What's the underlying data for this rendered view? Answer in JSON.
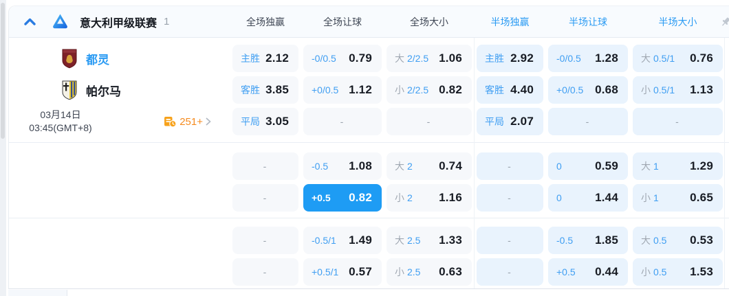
{
  "league": {
    "name": "意大利甲级联赛",
    "count": "1"
  },
  "header": {
    "columns": [
      {
        "label": "全场独赢",
        "tone": "dark"
      },
      {
        "label": "全场让球",
        "tone": "dark"
      },
      {
        "label": "全场大小",
        "tone": "dark"
      },
      {
        "label": "半场独赢",
        "tone": "blue"
      },
      {
        "label": "半场让球",
        "tone": "blue"
      },
      {
        "label": "半场大小",
        "tone": "blue"
      }
    ]
  },
  "teams": {
    "home": {
      "name": "都灵"
    },
    "away": {
      "name": "帕尔马"
    }
  },
  "schedule": {
    "date": "03月14日",
    "time": "03:45(GMT+8)"
  },
  "stats": {
    "count": "251+"
  },
  "icons": {
    "collapse": "chevron-up-icon",
    "league_logo": "serie-a-logo",
    "home_crest": "torino-crest",
    "away_crest": "parma-crest",
    "stats": "stats-history-icon",
    "more": "chevron-right-icon",
    "pin": "pin-icon"
  },
  "colors": {
    "accent_blue": "#2b9bf3",
    "label_blue": "#3f9ef2",
    "selected_cell_bg": "#1e9cf4",
    "full_cell_bg": "#f6f8fb",
    "half_cell_bg": "#e9f3fd",
    "value_dark": "#181c24",
    "muted_gray": "#9aa3ad",
    "stats_orange": "#f58b1f"
  },
  "odds": {
    "dash": "-",
    "groups": [
      {
        "rows": [
          [
            {
              "label": "主胜",
              "value": "2.12"
            },
            {
              "label": "-0/0.5",
              "value": "0.79"
            },
            {
              "prefix": "大",
              "label": "2/2.5",
              "value": "1.06"
            },
            {
              "label": "主胜",
              "value": "2.92"
            },
            {
              "label": "-0/0.5",
              "value": "1.28"
            },
            {
              "prefix": "大",
              "label": "0.5/1",
              "value": "0.76"
            }
          ],
          [
            {
              "label": "客胜",
              "value": "3.85"
            },
            {
              "label": "+0/0.5",
              "value": "1.12"
            },
            {
              "prefix": "小",
              "label": "2/2.5",
              "value": "0.82"
            },
            {
              "label": "客胜",
              "value": "4.40"
            },
            {
              "label": "+0/0.5",
              "value": "0.68"
            },
            {
              "prefix": "小",
              "label": "0.5/1",
              "value": "1.13"
            }
          ],
          [
            {
              "label": "平局",
              "value": "3.05"
            },
            {
              "dash": true
            },
            {
              "dash": true
            },
            {
              "label": "平局",
              "value": "2.07"
            },
            {
              "dash": true
            },
            {
              "dash": true
            }
          ]
        ]
      },
      {
        "rows": [
          [
            {
              "dash": true
            },
            {
              "label": "-0.5",
              "value": "1.08"
            },
            {
              "prefix": "大",
              "label": "2",
              "value": "0.74"
            },
            {
              "dash": true
            },
            {
              "label": "0",
              "value": "0.59"
            },
            {
              "prefix": "大",
              "label": "1",
              "value": "1.29"
            }
          ],
          [
            {
              "dash": true
            },
            {
              "label": "+0.5",
              "value": "0.82",
              "selected": true
            },
            {
              "prefix": "小",
              "label": "2",
              "value": "1.16"
            },
            {
              "dash": true
            },
            {
              "label": "0",
              "value": "1.44"
            },
            {
              "prefix": "小",
              "label": "1",
              "value": "0.65"
            }
          ]
        ]
      },
      {
        "rows": [
          [
            {
              "dash": true
            },
            {
              "label": "-0.5/1",
              "value": "1.49"
            },
            {
              "prefix": "大",
              "label": "2.5",
              "value": "1.33"
            },
            {
              "dash": true
            },
            {
              "label": "-0.5",
              "value": "1.85"
            },
            {
              "prefix": "大",
              "label": "0.5",
              "value": "0.53"
            }
          ],
          [
            {
              "dash": true
            },
            {
              "label": "+0.5/1",
              "value": "0.57"
            },
            {
              "prefix": "小",
              "label": "2.5",
              "value": "0.63"
            },
            {
              "dash": true
            },
            {
              "label": "+0.5",
              "value": "0.44"
            },
            {
              "prefix": "小",
              "label": "0.5",
              "value": "1.53"
            }
          ]
        ]
      }
    ]
  }
}
